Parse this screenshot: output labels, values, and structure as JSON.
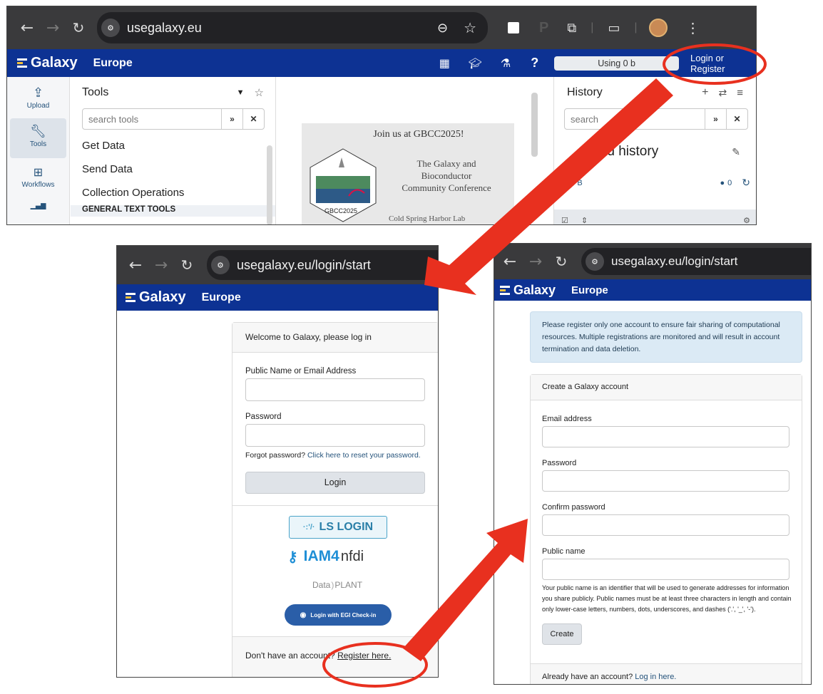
{
  "top": {
    "url": "usegalaxy.eu",
    "brand": "Galaxy",
    "region": "Europe",
    "usage": "Using 0 b",
    "login": "Login or Register",
    "activity": [
      {
        "label": "Upload",
        "icon": "upload-icon"
      },
      {
        "label": "Tools",
        "icon": "wrench-icon"
      },
      {
        "label": "Workflows",
        "icon": "sitemap-icon"
      }
    ],
    "tools": {
      "title": "Tools",
      "placeholder": "search tools",
      "items": [
        "Get Data",
        "Send Data",
        "Collection Operations"
      ],
      "section": "GENERAL TEXT TOOLS"
    },
    "banner": {
      "heading": "Join us at GBCC2025!",
      "line1": "The Galaxy and",
      "line2": "Bioconductor",
      "line3": "Community Conference",
      "footer": "Cold Spring Harbor Lab",
      "badge": "GBCC2025"
    },
    "history": {
      "title": "History",
      "placeholder": "search",
      "name": "med history",
      "size": "0 B",
      "count": "0"
    }
  },
  "login": {
    "url": "usegalaxy.eu/login/start",
    "brand": "Galaxy",
    "region": "Europe",
    "heading": "Welcome to Galaxy, please log in",
    "user_label": "Public Name or Email Address",
    "password_label": "Password",
    "forgot": "Forgot password?",
    "reset_link": "Click here to reset your password.",
    "login_button": "Login",
    "ls_login": "LS LOGIN",
    "iam": "IAM4",
    "nfdi": "nfdi",
    "dataplant_left": "Data",
    "dataplant_right": "PLANT",
    "egi": "Login with EGI Check-in",
    "no_account": "Don't have an account?",
    "register_link": "Register here."
  },
  "register": {
    "url": "usegalaxy.eu/login/start",
    "brand": "Galaxy",
    "region": "Europe",
    "notice": "Please register only one account to ensure fair sharing of computational resources. Multiple registrations are monitored and will result in account termination and data deletion.",
    "heading": "Create a Galaxy account",
    "email_label": "Email address",
    "password_label": "Password",
    "confirm_label": "Confirm password",
    "public_label": "Public name",
    "public_help": "Your public name is an identifier that will be used to generate addresses for information you share publicly. Public names must be at least three characters in length and contain only lower-case letters, numbers, dots, underscores, and dashes ('.', '_', '-').",
    "create_button": "Create",
    "have_account": "Already have an account?",
    "login_link": "Log in here."
  },
  "colors": {
    "galaxy_blue": "#0d3293",
    "annotation_red": "#e8301f",
    "chrome_dark": "#3a3a3c"
  }
}
